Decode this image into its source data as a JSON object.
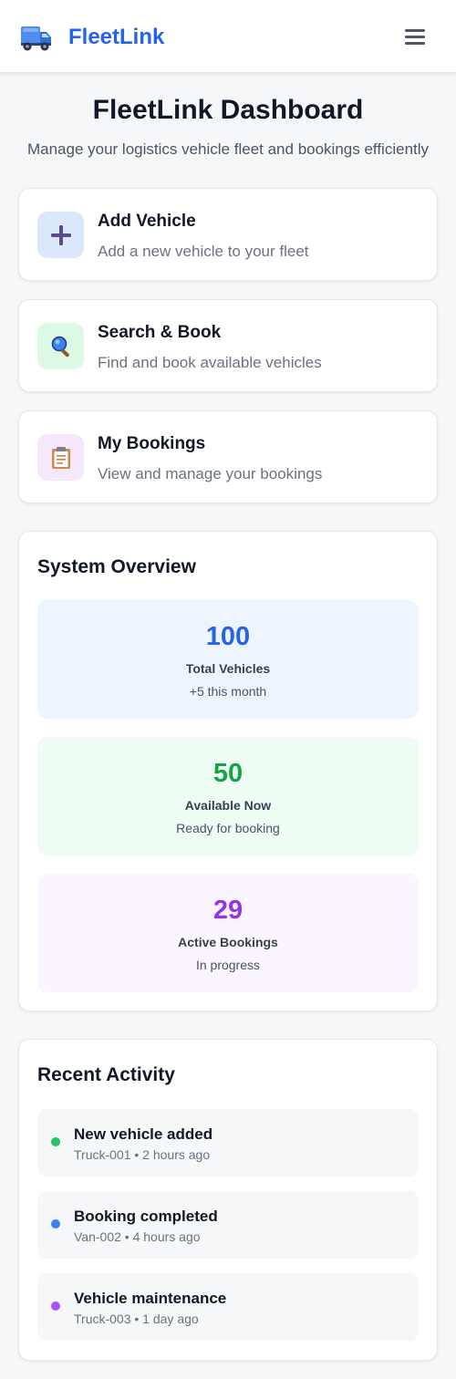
{
  "app": {
    "name": "FleetLink",
    "icon": "truck-icon"
  },
  "header": {
    "menu_icon": "hamburger-menu-icon"
  },
  "page": {
    "title": "FleetLink Dashboard",
    "subtitle": "Manage your logistics vehicle fleet and bookings efficiently"
  },
  "actions": [
    {
      "title": "Add Vehicle",
      "description": "Add a new vehicle to your fleet",
      "icon": "plus-icon",
      "icon_bg": "#dbe7fb"
    },
    {
      "title": "Search & Book",
      "description": "Find and book available vehicles",
      "icon": "magnifier-icon",
      "icon_bg": "#dcf9e6"
    },
    {
      "title": "My Bookings",
      "description": "View and manage your bookings",
      "icon": "clipboard-icon",
      "icon_bg": "#f5e8fd"
    }
  ],
  "overview": {
    "title": "System Overview",
    "stats": [
      {
        "value": "100",
        "label": "Total Vehicles",
        "note": "+5 this month",
        "color": "#2563eb",
        "bg": "#eff5ff"
      },
      {
        "value": "50",
        "label": "Available Now",
        "note": "Ready for booking",
        "color": "#16a34a",
        "bg": "#effcf3"
      },
      {
        "value": "29",
        "label": "Active Bookings",
        "note": "In progress",
        "color": "#9333ea",
        "bg": "#faf5ff"
      }
    ]
  },
  "activity": {
    "title": "Recent Activity",
    "items": [
      {
        "title": "New vehicle added",
        "meta": "Truck-001 • 2 hours ago",
        "dot_color": "#22c55e"
      },
      {
        "title": "Booking completed",
        "meta": "Van-002 • 4 hours ago",
        "dot_color": "#3b82f6"
      },
      {
        "title": "Vehicle maintenance",
        "meta": "Truck-003 • 1 day ago",
        "dot_color": "#a855f7"
      }
    ]
  }
}
